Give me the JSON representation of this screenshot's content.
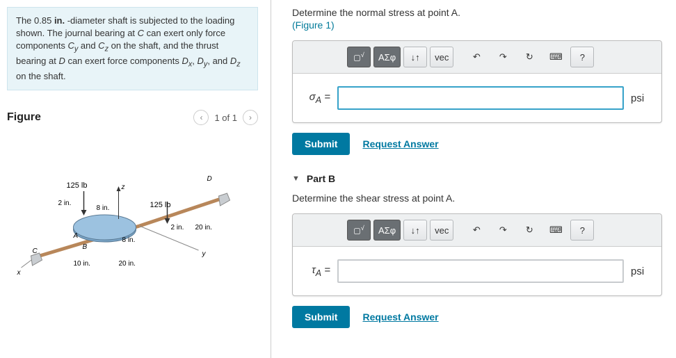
{
  "problem": {
    "text_html": "The 0.85 in. -diameter shaft is subjected to the loading shown. The journal bearing at C can exert only force components C_y and C_z on the shaft, and the thrust bearing at D can exert force components D_x, D_y, and D_z on the shaft."
  },
  "figure": {
    "heading": "Figure",
    "pager": "1 of 1",
    "labels": {
      "load1": "125 lb",
      "load2": "125 lb",
      "d1": "2 in.",
      "d2": "8 in.",
      "d3": "8 in.",
      "d4": "10 in.",
      "d5": "20 in.",
      "d6": "2 in.",
      "d7": "20 in.",
      "ptA": "A",
      "ptB": "B",
      "ptC": "C",
      "ptD": "D",
      "ax_x": "x",
      "ax_y": "y",
      "ax_z": "z"
    }
  },
  "partA": {
    "prompt": "Determine the normal stress at point A.",
    "figref": "(Figure 1)",
    "var": "σA =",
    "unit": "psi"
  },
  "partB": {
    "heading": "Part B",
    "prompt": "Determine the shear stress at point A.",
    "var": "τA =",
    "unit": "psi"
  },
  "toolbar": {
    "templates": "▢√▢",
    "greek": "ΑΣφ",
    "scripts": "↓↑",
    "vec": "vec",
    "undo": "↶",
    "redo": "↷",
    "reset": "↻",
    "keyboard": "⌨",
    "help": "?"
  },
  "actions": {
    "submit": "Submit",
    "request": "Request Answer"
  }
}
